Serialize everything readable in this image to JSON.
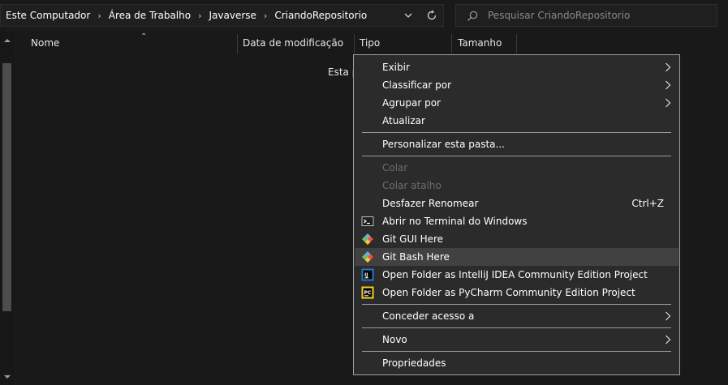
{
  "address_bar": {
    "crumbs": [
      "Este Computador",
      "Área de Trabalho",
      "Javaverse",
      "CriandoRepositorio"
    ]
  },
  "search": {
    "placeholder": "Pesquisar CriandoRepositorio"
  },
  "columns": {
    "name": "Nome",
    "modified": "Data de modificação",
    "type": "Tipo",
    "size": "Tamanho"
  },
  "empty_text": "Esta p",
  "context_menu": {
    "items": [
      {
        "label": "Exibir",
        "submenu": true
      },
      {
        "label": "Classificar por",
        "submenu": true
      },
      {
        "label": "Agrupar por",
        "submenu": true
      },
      {
        "label": "Atualizar"
      },
      {
        "label": "Personalizar esta pasta..."
      },
      {
        "label": "Colar",
        "disabled": true
      },
      {
        "label": "Colar atalho",
        "disabled": true
      },
      {
        "label": "Desfazer Renomear",
        "shortcut": "Ctrl+Z"
      },
      {
        "label": "Abrir no Terminal do Windows",
        "icon": "terminal-icon"
      },
      {
        "label": "Git GUI Here",
        "icon": "git-icon"
      },
      {
        "label": "Git Bash Here",
        "icon": "git-icon",
        "hovered": true
      },
      {
        "label": "Open Folder as IntelliJ IDEA Community Edition Project",
        "icon": "intellij-icon",
        "icon_text": "IJ"
      },
      {
        "label": "Open Folder as PyCharm Community Edition Project",
        "icon": "pycharm-icon",
        "icon_text": "PC"
      },
      {
        "label": "Conceder acesso a",
        "submenu": true
      },
      {
        "label": "Novo",
        "submenu": true
      },
      {
        "label": "Propriedades"
      }
    ]
  },
  "colors": {
    "background": "#191919",
    "menu_bg": "#2b2b2b",
    "menu_hover": "#414141",
    "disabled_text": "#6d6d6d",
    "git_orange": "#f05133",
    "pycharm_yellow": "#f0d22a"
  }
}
